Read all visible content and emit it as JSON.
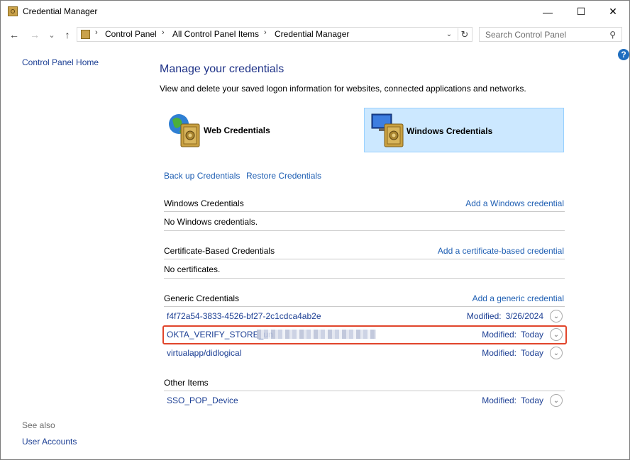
{
  "window": {
    "title": "Credential Manager",
    "minimize": "—",
    "maximize": "☐",
    "close": "✕"
  },
  "nav": {
    "back": "←",
    "forward": "→",
    "recent": "⌄",
    "up": "↑"
  },
  "address": {
    "crumbs": [
      "Control Panel",
      "All Control Panel Items",
      "Credential Manager"
    ],
    "sep": "›",
    "dropdown": "⌄",
    "refresh": "↻"
  },
  "search": {
    "placeholder": "Search Control Panel",
    "icon": "⚲"
  },
  "help": "?",
  "left": {
    "home": "Control Panel Home",
    "see_also": "See also",
    "user_accounts": "User Accounts"
  },
  "main": {
    "title": "Manage your credentials",
    "description": "View and delete your saved logon information for websites, connected applications and networks.",
    "tiles": {
      "web": "Web Credentials",
      "windows": "Windows Credentials"
    },
    "backup": "Back up Credentials",
    "restore": "Restore Credentials",
    "sections": {
      "windows": {
        "label": "Windows Credentials",
        "add": "Add a Windows credential",
        "empty": "No Windows credentials."
      },
      "cert": {
        "label": "Certificate-Based Credentials",
        "add": "Add a certificate-based credential",
        "empty": "No certificates."
      },
      "generic": {
        "label": "Generic Credentials",
        "add": "Add a generic credential",
        "items": [
          {
            "name": "f4f72a54-3833-4526-bf27-2c1cdca4ab2e",
            "modified_label": "Modified:",
            "modified": "3/26/2024"
          },
          {
            "name": "OKTA_VERIFY_STORE_un",
            "modified_label": "Modified:",
            "modified": "Today"
          },
          {
            "name": "virtualapp/didlogical",
            "modified_label": "Modified:",
            "modified": "Today"
          }
        ]
      },
      "other": {
        "label": "Other Items",
        "items": [
          {
            "name": "SSO_POP_Device",
            "modified_label": "Modified:",
            "modified": "Today"
          }
        ]
      }
    }
  },
  "icons": {
    "chevron": "⌄"
  },
  "colors": {
    "link": "#1f5fb3",
    "title": "#1e3287",
    "selected_tile": "#cce8ff",
    "highlight": "#e1452b"
  }
}
